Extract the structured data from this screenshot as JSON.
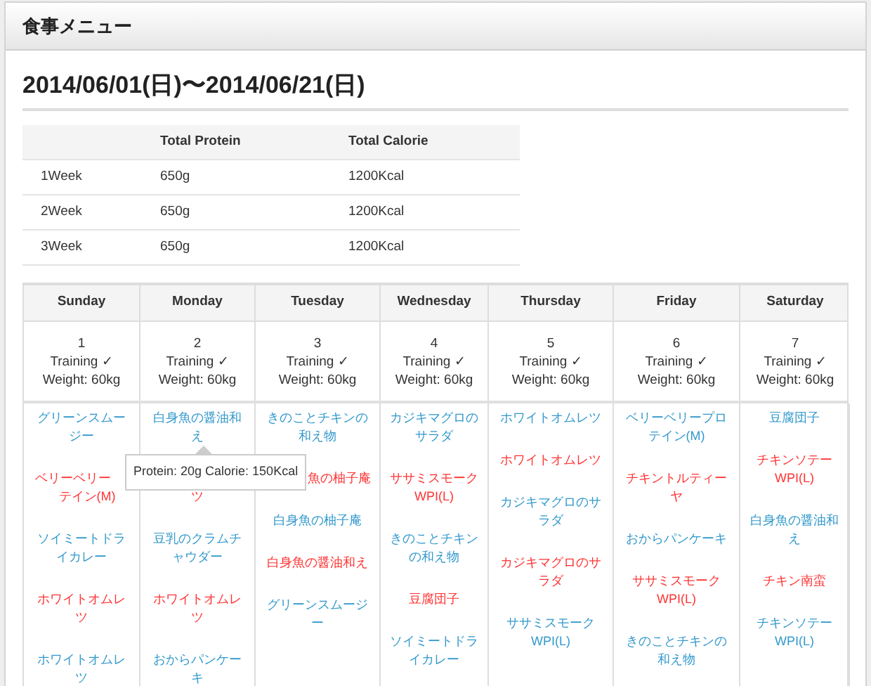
{
  "header": {
    "title": "食事メニュー"
  },
  "period": "2014/06/01(日)〜2014/06/21(日)",
  "summary": {
    "columns": [
      "Total Protein",
      "Total Calorie"
    ],
    "rows": [
      {
        "label": "1Week",
        "protein": "650g",
        "calorie": "1200Kcal"
      },
      {
        "label": "2Week",
        "protein": "650g",
        "calorie": "1200Kcal"
      },
      {
        "label": "3Week",
        "protein": "650g",
        "calorie": "1200Kcal"
      }
    ]
  },
  "calendar": {
    "days": [
      {
        "name": "Sunday",
        "date": "1",
        "training": "Training ✓",
        "weight": "Weight: 60kg",
        "meals": [
          {
            "text": "グリーンスムージー",
            "color": "#3399cc"
          },
          {
            "kind": "cut_end",
            "text": "ベリーベリー",
            "rest": "テイン(M)",
            "color": "#ff3333"
          },
          {
            "text": "ソイミートドライカレー",
            "color": "#3399cc"
          },
          {
            "text": "ホワイトオムレツ",
            "color": "#ff3333"
          },
          {
            "text": "ホワイトオムレツ",
            "color": "#3399cc"
          }
        ]
      },
      {
        "name": "Monday",
        "date": "2",
        "training": "Training ✓",
        "weight": "Weight: 60kg",
        "meals": [
          {
            "text": "白身魚の醤油和え",
            "color": "#3399cc"
          },
          {
            "kind": "cut_top",
            "text": "ツ",
            "color": "#ff3333"
          },
          {
            "text": "豆乳のクラムチャウダー",
            "color": "#3399cc"
          },
          {
            "text": "ホワイトオムレツ",
            "color": "#ff3333"
          },
          {
            "text": "おからパンケーキ",
            "color": "#3399cc"
          }
        ]
      },
      {
        "name": "Tuesday",
        "date": "3",
        "training": "Training ✓",
        "weight": "Weight: 60kg",
        "meals": [
          {
            "text": "きのことチキンの和え物",
            "color": "#3399cc"
          },
          {
            "kind": "cut_start",
            "text": "魚の柚子庵",
            "color": "#ff3333"
          },
          {
            "text": "白身魚の柚子庵",
            "color": "#3399cc"
          },
          {
            "text": "白身魚の醤油和え",
            "color": "#ff3333"
          },
          {
            "text": "グリーンスムージー",
            "color": "#3399cc"
          }
        ]
      },
      {
        "name": "Wednesday",
        "date": "4",
        "training": "Training ✓",
        "weight": "Weight: 60kg",
        "meals": [
          {
            "text": "カジキマグロのサラダ",
            "color": "#3399cc"
          },
          {
            "text": "ササミスモークWPI(L)",
            "color": "#ff3333"
          },
          {
            "text": "きのことチキンの和え物",
            "color": "#3399cc"
          },
          {
            "text": "豆腐団子",
            "color": "#ff3333"
          },
          {
            "text": "ソイミートドライカレー",
            "color": "#3399cc"
          }
        ]
      },
      {
        "name": "Thursday",
        "date": "5",
        "training": "Training ✓",
        "weight": "Weight: 60kg",
        "meals": [
          {
            "text": "ホワイトオムレツ",
            "color": "#3399cc"
          },
          {
            "text": "ホワイトオムレツ",
            "color": "#ff3333"
          },
          {
            "text": "カジキマグロのサラダ",
            "color": "#3399cc"
          },
          {
            "text": "カジキマグロのサラダ",
            "color": "#ff3333"
          },
          {
            "text": "ササミスモークWPI(L)",
            "color": "#3399cc"
          }
        ]
      },
      {
        "name": "Friday",
        "date": "6",
        "training": "Training ✓",
        "weight": "Weight: 60kg",
        "meals": [
          {
            "text": "ベリーベリープロテイン(M)",
            "color": "#3399cc"
          },
          {
            "text": "チキントルティーヤ",
            "color": "#ff3333"
          },
          {
            "text": "おからパンケーキ",
            "color": "#3399cc"
          },
          {
            "text": "ササミスモークWPI(L)",
            "color": "#ff3333"
          },
          {
            "text": "きのことチキンの和え物",
            "color": "#3399cc"
          }
        ]
      },
      {
        "name": "Saturday",
        "date": "7",
        "training": "Training ✓",
        "weight": "Weight: 60kg",
        "meals": [
          {
            "text": "豆腐団子",
            "color": "#3399cc"
          },
          {
            "text": "チキンソテーWPI(L)",
            "color": "#ff3333"
          },
          {
            "text": "白身魚の醤油和え",
            "color": "#3399cc"
          },
          {
            "text": "チキン南蛮",
            "color": "#ff3333"
          },
          {
            "text": "チキンソテーWPI(L)",
            "color": "#3399cc"
          }
        ]
      }
    ],
    "tooltip": "Protein: 20g Calorie: 150Kcal"
  }
}
